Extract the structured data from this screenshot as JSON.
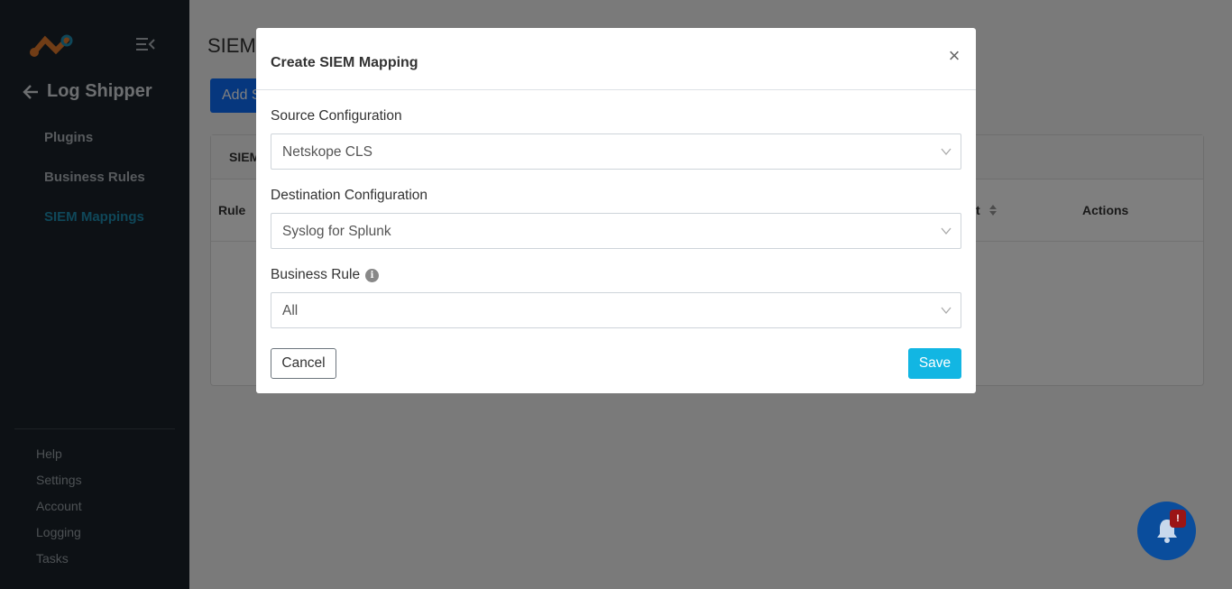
{
  "sidebar": {
    "back_title": "Log Shipper",
    "nav": [
      {
        "label": "Plugins"
      },
      {
        "label": "Business Rules"
      },
      {
        "label": "SIEM Mappings"
      }
    ],
    "bottom_links": [
      {
        "label": "Help"
      },
      {
        "label": "Settings"
      },
      {
        "label": "Account"
      },
      {
        "label": "Logging"
      },
      {
        "label": "Tasks"
      }
    ]
  },
  "main": {
    "page_title": "SIEM",
    "add_button_label": "Add S",
    "card_title": "SIEM",
    "columns": {
      "rule": "Rule",
      "count_partial": "t",
      "actions": "Actions"
    }
  },
  "modal": {
    "title": "Create SIEM Mapping",
    "close_symbol": "×",
    "source_label": "Source Configuration",
    "source_value": "Netskope CLS",
    "destination_label": "Destination Configuration",
    "destination_value": "Syslog for Splunk",
    "business_rule_label": "Business Rule",
    "info_symbol": "i",
    "business_rule_value": "All",
    "cancel_label": "Cancel",
    "save_label": "Save"
  },
  "notifications": {
    "badge": "!"
  },
  "colors": {
    "sidebar_bg": "#1a232b",
    "active_nav": "#1e8fb3",
    "save": "#12b6e3",
    "bell": "#0a4d9c"
  }
}
